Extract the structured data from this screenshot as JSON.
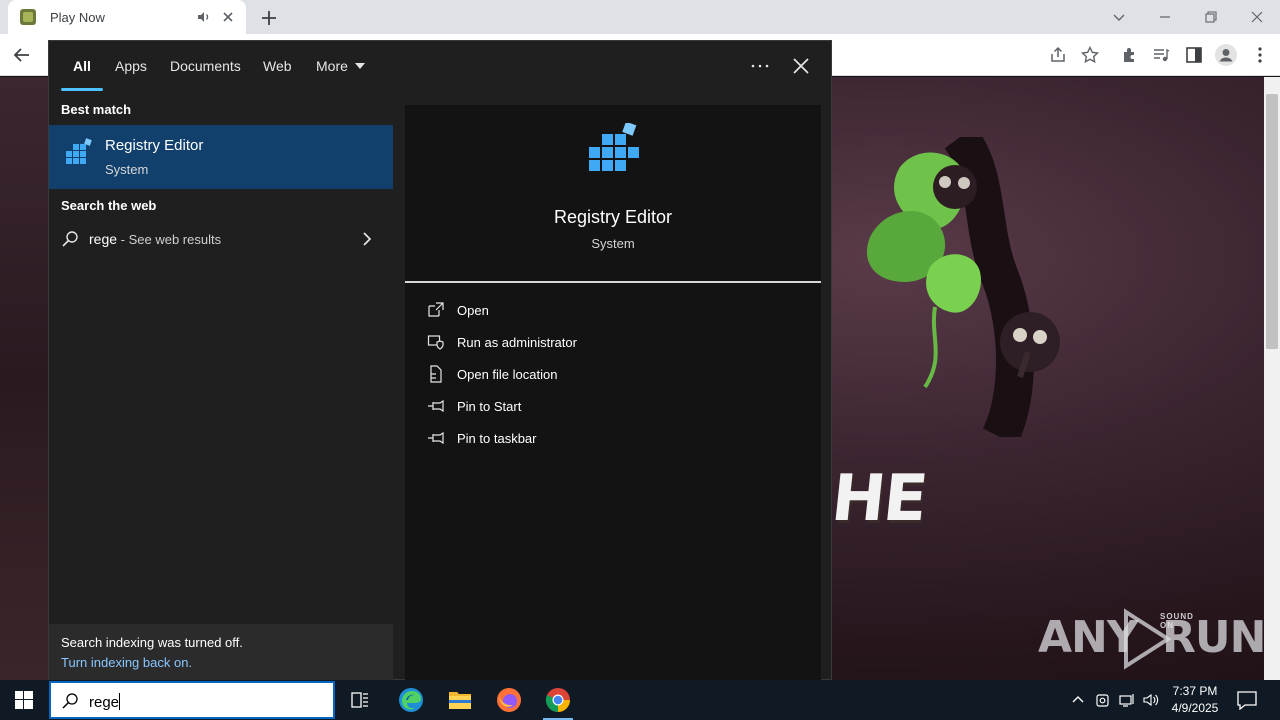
{
  "browser": {
    "tab_title": "Play Now",
    "icons": [
      "audio-icon",
      "close-icon",
      "plus-icon",
      "back-icon",
      "share-icon",
      "star-icon",
      "extensions-icon",
      "media-icon",
      "sidepanel-icon",
      "profile-icon",
      "menu-icon"
    ]
  },
  "page": {
    "game_word": "HE",
    "watermark": {
      "text": "ANY",
      "text2": "RUN",
      "sound_label": "SOUND ON"
    }
  },
  "search_panel": {
    "tabs": [
      {
        "label": "All",
        "active": true
      },
      {
        "label": "Apps"
      },
      {
        "label": "Documents"
      },
      {
        "label": "Web"
      },
      {
        "label": "More"
      }
    ],
    "best_match_heading": "Best match",
    "best_match": {
      "title": "Registry Editor",
      "subtitle": "System"
    },
    "web_heading": "Search the web",
    "web_result": {
      "query": "rege",
      "suffix": " - See web results"
    },
    "indexing": {
      "message": "Search indexing was turned off.",
      "link": "Turn indexing back on."
    },
    "preview": {
      "title": "Registry Editor",
      "subtitle": "System",
      "actions": [
        {
          "label": "Open",
          "icon": "open-icon"
        },
        {
          "label": "Run as administrator",
          "icon": "shield-icon"
        },
        {
          "label": "Open file location",
          "icon": "file-location-icon"
        },
        {
          "label": "Pin to Start",
          "icon": "pin-icon"
        },
        {
          "label": "Pin to taskbar",
          "icon": "pin-icon"
        }
      ]
    },
    "accent_color": "#10406b",
    "underline_color": "#4cc2ff"
  },
  "taskbar": {
    "search_text": "rege",
    "apps": [
      "task-view-icon",
      "edge-icon",
      "file-explorer-icon",
      "firefox-icon",
      "chrome-icon"
    ],
    "clock_time": "7:37 PM",
    "clock_date": "4/9/2025"
  }
}
